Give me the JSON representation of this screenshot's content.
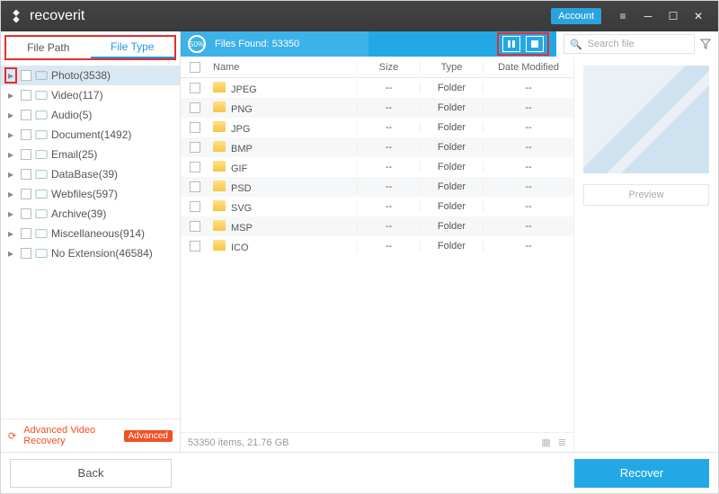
{
  "app": {
    "name": "recoverit",
    "account_label": "Account"
  },
  "sidebar": {
    "tabs": {
      "path": "File Path",
      "type": "File Type",
      "active": "type"
    },
    "items": [
      {
        "icon": "image",
        "label": "Photo(3538)",
        "selected": true
      },
      {
        "icon": "video",
        "label": "Video(117)"
      },
      {
        "icon": "audio",
        "label": "Audio(5)"
      },
      {
        "icon": "doc",
        "label": "Document(1492)"
      },
      {
        "icon": "email",
        "label": "Email(25)"
      },
      {
        "icon": "db",
        "label": "DataBase(39)"
      },
      {
        "icon": "web",
        "label": "Webfiles(597)"
      },
      {
        "icon": "archive",
        "label": "Archive(39)"
      },
      {
        "icon": "misc",
        "label": "Miscellaneous(914)"
      },
      {
        "icon": "noext",
        "label": "No Extension(46584)"
      }
    ],
    "advanced": {
      "label": "Advanced Video Recovery",
      "badge": "Advanced"
    }
  },
  "scan": {
    "progress_label": "50%",
    "files_found_label": "Files Found:  53350"
  },
  "search": {
    "placeholder": "Search file"
  },
  "columns": {
    "name": "Name",
    "size": "Size",
    "type": "Type",
    "date": "Date Modified"
  },
  "rows": [
    {
      "name": "JPEG",
      "size": "--",
      "type": "Folder",
      "date": "--"
    },
    {
      "name": "PNG",
      "size": "--",
      "type": "Folder",
      "date": "--"
    },
    {
      "name": "JPG",
      "size": "--",
      "type": "Folder",
      "date": "--"
    },
    {
      "name": "BMP",
      "size": "--",
      "type": "Folder",
      "date": "--"
    },
    {
      "name": "GIF",
      "size": "--",
      "type": "Folder",
      "date": "--"
    },
    {
      "name": "PSD",
      "size": "--",
      "type": "Folder",
      "date": "--"
    },
    {
      "name": "SVG",
      "size": "--",
      "type": "Folder",
      "date": "--"
    },
    {
      "name": "MSP",
      "size": "--",
      "type": "Folder",
      "date": "--"
    },
    {
      "name": "ICO",
      "size": "--",
      "type": "Folder",
      "date": "--"
    }
  ],
  "preview": {
    "label": "Preview"
  },
  "status": {
    "summary": "53350 items, 21.76  GB"
  },
  "footer": {
    "back": "Back",
    "recover": "Recover"
  }
}
